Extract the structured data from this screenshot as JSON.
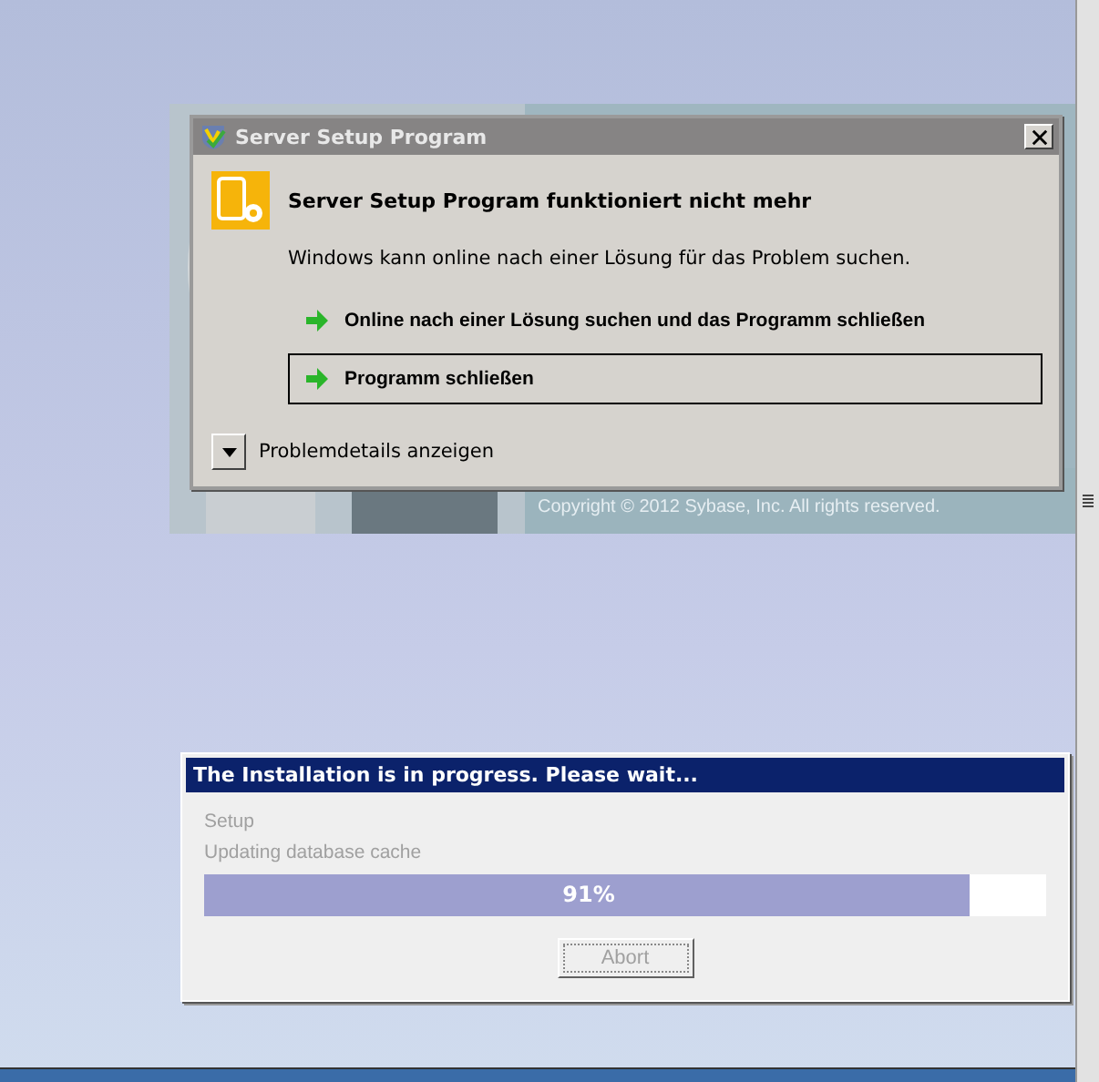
{
  "splash": {
    "copyright": "Copyright © 2012 Sybase, Inc.  All rights reserved."
  },
  "error_dialog": {
    "title": "Server Setup Program",
    "heading": "Server Setup Program funktioniert nicht mehr",
    "message": "Windows kann online nach einer Lösung für das Problem suchen.",
    "options": [
      {
        "label": "Online nach einer Lösung suchen und das Programm schließen",
        "focused": false
      },
      {
        "label": "Programm schließen",
        "focused": true
      }
    ],
    "details_toggle": "Problemdetails anzeigen"
  },
  "progress_window": {
    "title": "The Installation is in progress.  Please wait...",
    "lines": [
      "Setup",
      "Updating database cache"
    ],
    "progress": {
      "level": 0.91,
      "label": "91%"
    },
    "abort_button": {
      "label": "Abort",
      "disabled": true
    }
  }
}
